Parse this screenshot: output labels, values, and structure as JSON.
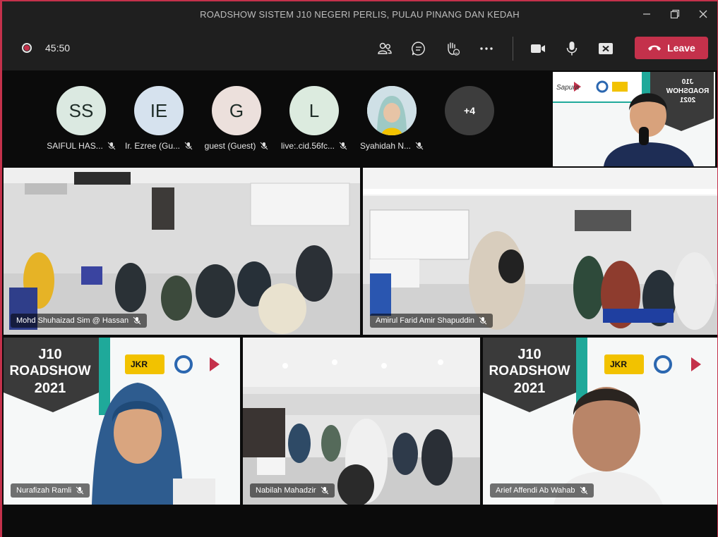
{
  "window": {
    "title": "ROADSHOW SISTEM J10 NEGERI PERLIS, PULAU PINANG DAN KEDAH"
  },
  "toolbar": {
    "timer": "45:50",
    "leave_label": "Leave"
  },
  "participants": [
    {
      "initials": "SS",
      "name": "SAIFUL HAS...",
      "color": "#dbe9e1"
    },
    {
      "initials": "IE",
      "name": "Ir. Ezree (Gu...",
      "color": "#d6e2ee"
    },
    {
      "initials": "G",
      "name": "guest (Guest)",
      "color": "#ece0dc"
    },
    {
      "initials": "L",
      "name": "live:.cid.56fc...",
      "color": "#dcebdf"
    },
    {
      "initials": "",
      "name": "Syahidah N..."
    }
  ],
  "overflow_count": "+4",
  "tiles": [
    {
      "name": "Mohd Shuhaizad Sim @ Hassan"
    },
    {
      "name": "Amirul Farid Amir Shapuddin"
    },
    {
      "name": "Nurafizah Ramli"
    },
    {
      "name": "Nabilah Mahadzir"
    },
    {
      "name": "Arief Affendi Ab Wahab"
    }
  ],
  "branding": {
    "badge_line1": "J10",
    "badge_line2": "ROADSHOW",
    "badge_line3": "2021",
    "jkr": "JKR",
    "sapura": "Sapura"
  },
  "colors": {
    "accent_red": "#c4314b",
    "toolbar_bg": "#1f1f1f",
    "teal": "#1fa99a"
  }
}
